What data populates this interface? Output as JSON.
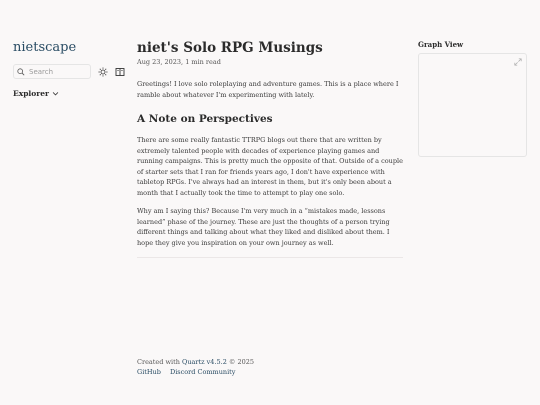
{
  "site": {
    "title": "nietscape"
  },
  "search": {
    "placeholder": "Search"
  },
  "explorer": {
    "label": "Explorer"
  },
  "article": {
    "title": "niet's Solo RPG Musings",
    "date": "Aug 23, 2023,",
    "read_time": "1 min read",
    "intro": "Greetings! I love solo roleplaying and adventure games. This is a place where I ramble about whatever I'm experimenting with lately.",
    "section_heading": "A Note on Perspectives",
    "para2": "There are some really fantastic TTRPG blogs out there that are written by extremely talented people with decades of experience playing games and running campaigns. This is pretty much the opposite of that. Outside of a couple of starter sets that I ran for friends years ago, I don't have experience with tabletop RPGs. I've always had an interest in them, but it's only been about a month that I actually took the time to attempt to play one solo.",
    "para3": "Why am I saying this? Because I'm very much in a “mistakes made, lessons learned” phase of the journey. These are just the thoughts of a person trying different things and talking about what they liked and disliked about them. I hope they give you inspiration on your own journey as well."
  },
  "graph": {
    "title": "Graph View"
  },
  "footer": {
    "created_prefix": "Created with",
    "quartz_link": "Quartz v4.5.2",
    "created_suffix": "© 2025",
    "links": [
      "GitHub",
      "Discord Community"
    ]
  },
  "colors": {
    "accent": "#284b63",
    "background": "#faf8f8"
  },
  "icons": [
    "search-icon",
    "sun-icon",
    "book-icon",
    "chevron-down-icon",
    "expand-icon"
  ]
}
